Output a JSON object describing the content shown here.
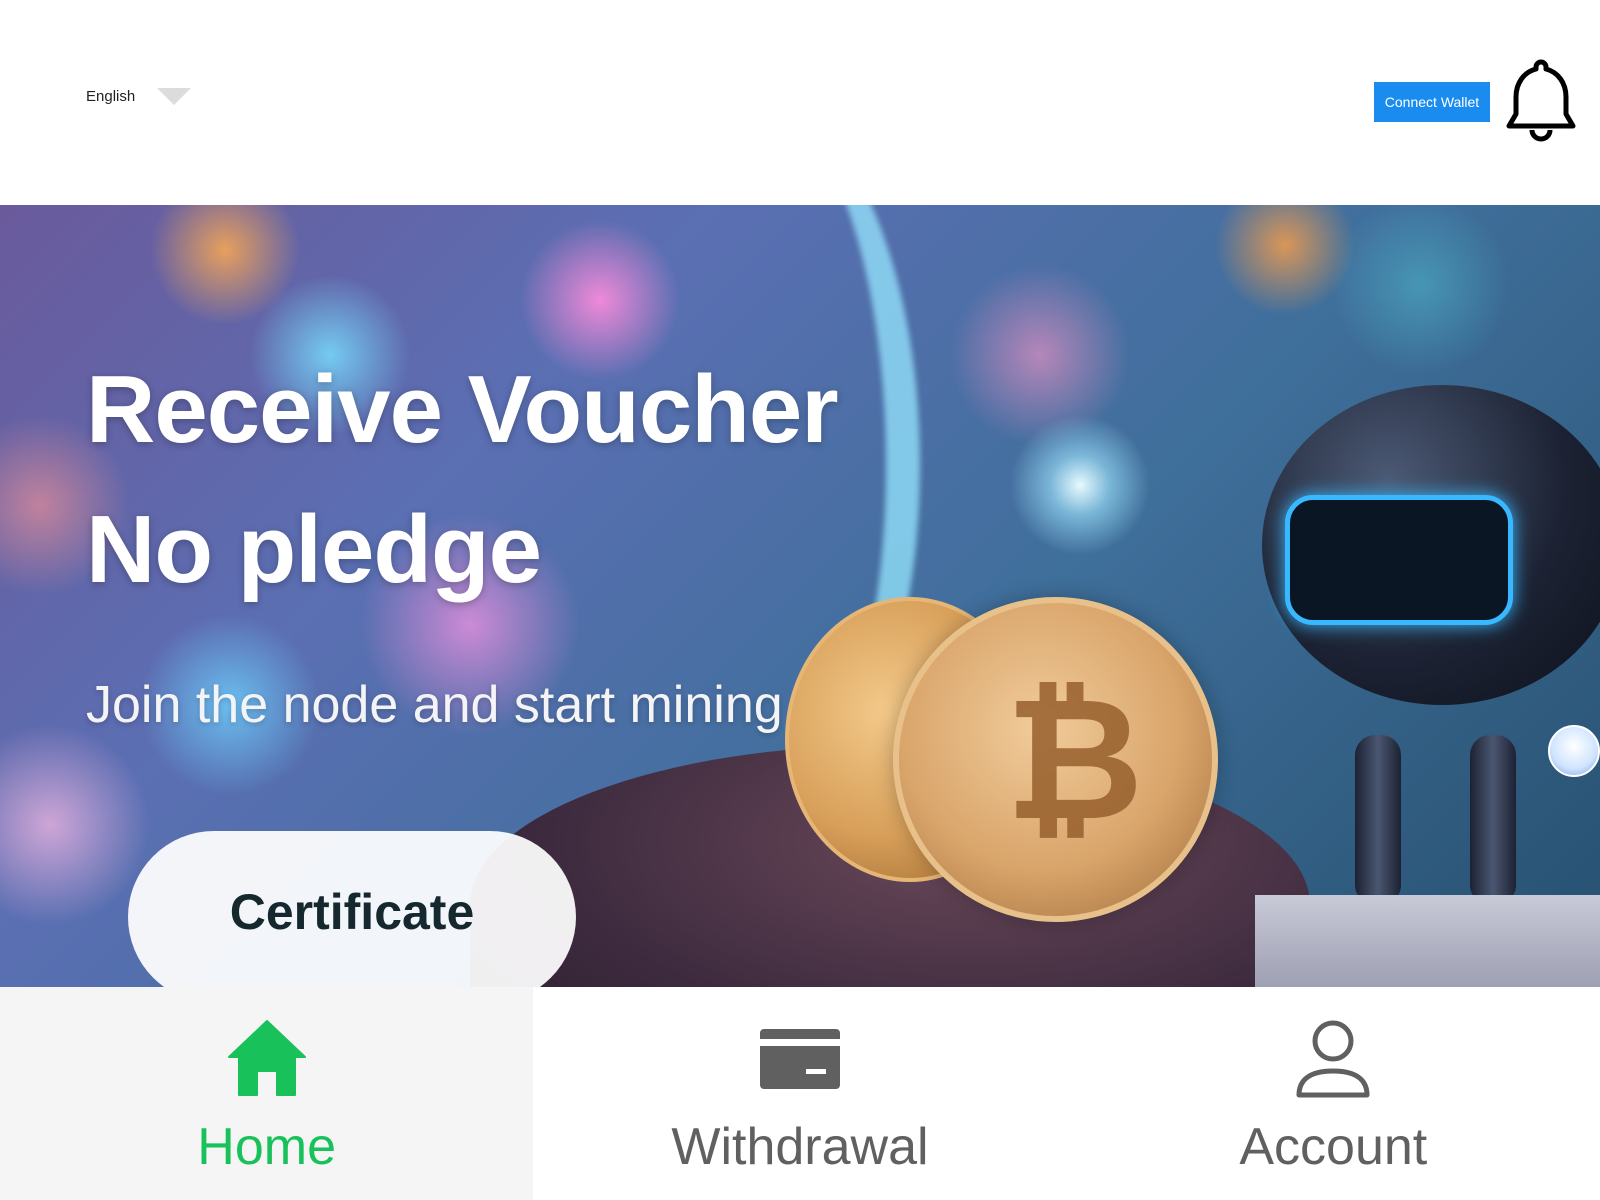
{
  "header": {
    "language_label": "English",
    "language_caret_icon": "chevron-down-icon",
    "connect_wallet_label": "Connect Wallet",
    "notification_icon": "bell-icon"
  },
  "hero": {
    "title_line1": "Receive Voucher",
    "title_line2": "No pledge",
    "subtitle": "Join the node and start mining",
    "certificate_button_label": "Certificate"
  },
  "bottom_nav": {
    "items": [
      {
        "label": "Home",
        "icon": "home-icon",
        "active": true
      },
      {
        "label": "Withdrawal",
        "icon": "wallet-card-icon",
        "active": false
      },
      {
        "label": "Account",
        "icon": "user-icon",
        "active": false
      }
    ]
  },
  "colors": {
    "accent_blue": "#1a8cf0",
    "active_green": "#19c15a",
    "inactive_gray": "#606060"
  }
}
